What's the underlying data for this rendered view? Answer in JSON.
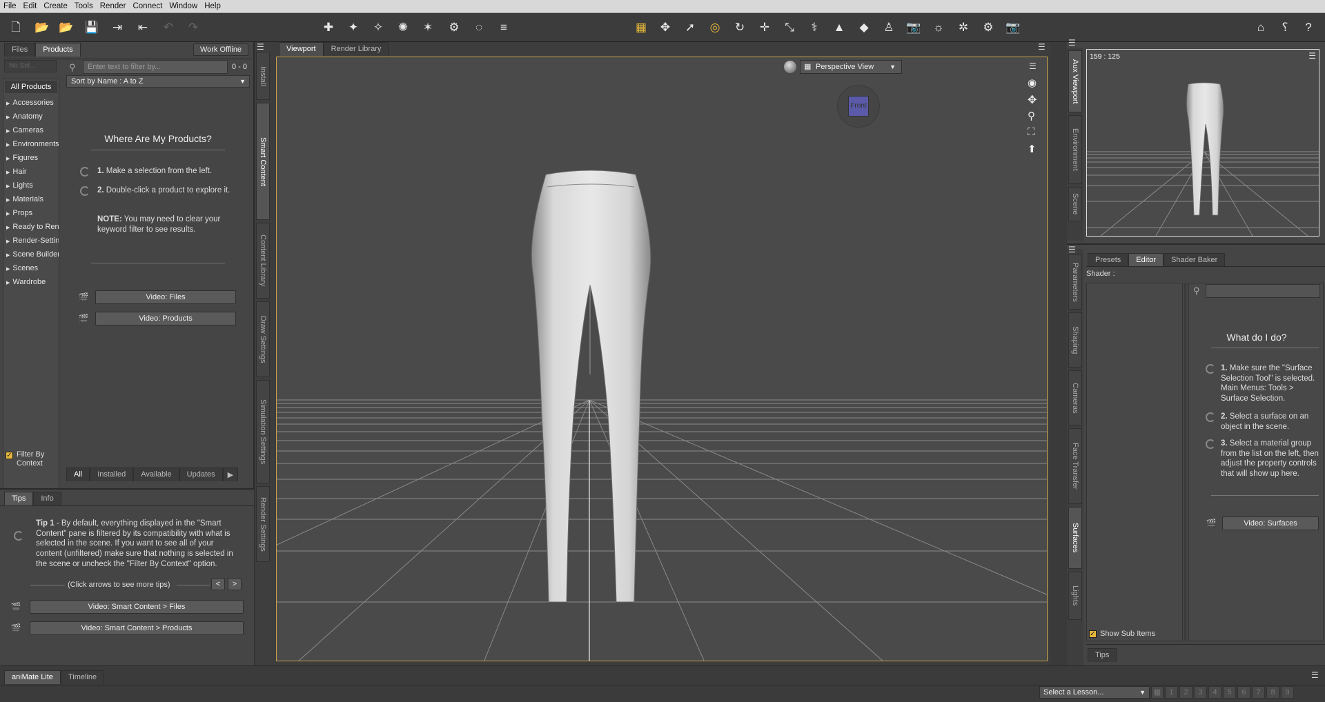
{
  "menu": [
    "File",
    "Edit",
    "Create",
    "Tools",
    "Render",
    "Connect",
    "Window",
    "Help"
  ],
  "left_panel": {
    "tabs": [
      "Files",
      "Products"
    ],
    "work_offline": "Work Offline",
    "category_dropdown": "No Sel...",
    "filter_placeholder": "Enter text to filter by...",
    "count": "0 - 0",
    "sort": "Sort by Name : A to Z",
    "all_products": "All Products",
    "categories": [
      "Accessories",
      "Anatomy",
      "Cameras",
      "Environments",
      "Figures",
      "Hair",
      "Lights",
      "Materials",
      "Props",
      "Ready to Render",
      "Render-Settings",
      "Scene Builder",
      "Scenes",
      "Wardrobe"
    ],
    "heading": "Where Are My Products?",
    "step1_num": "1.",
    "step1": "Make a selection from the left.",
    "step2_num": "2.",
    "step2": "Double-click a product to explore it.",
    "note_label": "NOTE:",
    "note": "You may need to clear your keyword filter to see results.",
    "video_files": "Video: Files",
    "video_products": "Video: Products",
    "filter_by_context": "Filter By Context",
    "bottom_tabs": [
      "All",
      "Installed",
      "Available",
      "Updates"
    ],
    "vertical_tabs": [
      "Install",
      "Smart Content",
      "Content Library",
      "Draw Settings",
      "Simulation Settings",
      "Render Settings"
    ]
  },
  "tips_panel": {
    "tabs": [
      "Tips",
      "Info"
    ],
    "tip_label": "Tip 1",
    "tip_text": "- By default, everything displayed in the \"Smart Content\" pane is filtered by its compatibility with what is selected in the scene. If you want to see all of your content (unfiltered) make sure that nothing is selected in the scene or uncheck the \"Filter By Context\" option.",
    "arrows_hint": "(Click arrows to see more tips)",
    "prev": "<",
    "next": ">",
    "video1": "Video: Smart Content > Files",
    "video2": "Video: Smart Content > Products"
  },
  "viewport": {
    "tabs": [
      "Viewport",
      "Render Library"
    ],
    "view_name": "Perspective View",
    "cube_label": "Front"
  },
  "right_panel": {
    "aux_coords": "159 : 125",
    "vertical_tabs_top": [
      "Aux Viewport",
      "Environment",
      "Scene"
    ],
    "tabs": [
      "Presets",
      "Editor",
      "Shader Baker"
    ],
    "shader_label": "Shader :",
    "heading": "What do I do?",
    "step1_num": "1.",
    "step1": "Make sure the \"Surface Selection Tool\" is selected. Main Menus: Tools > Surface Selection.",
    "step2_num": "2.",
    "step2": "Select a surface on an object in the scene.",
    "step3_num": "3.",
    "step3": "Select a material group from the list on the left, then adjust the property controls that will show up here.",
    "video": "Video: Surfaces",
    "show_sub_items": "Show Sub Items",
    "vertical_tabs": [
      "Parameters",
      "Shaping",
      "Cameras",
      "Face Transfer",
      "Surfaces",
      "Lights"
    ],
    "tips_tab": "Tips"
  },
  "bottom": {
    "tabs": [
      "aniMate Lite",
      "Timeline"
    ],
    "lesson": "Select a Lesson...",
    "pages": [
      "1",
      "2",
      "3",
      "4",
      "5",
      "6",
      "7",
      "8",
      "9"
    ]
  },
  "colors": {
    "accent": "#e5b83a",
    "viewport_border": "#c9a54a",
    "cube": "#5a5aa8"
  }
}
